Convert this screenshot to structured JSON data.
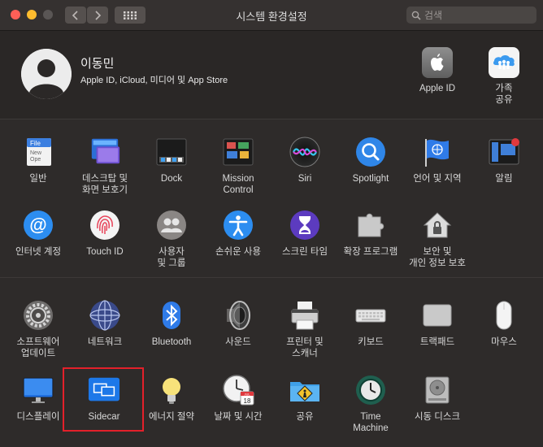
{
  "window": {
    "title": "시스템 환경설정"
  },
  "search": {
    "placeholder": "검색"
  },
  "account": {
    "name": "이동민",
    "subtitle": "Apple ID, iCloud, 미디어 및 App Store",
    "apple_id_label": "Apple ID",
    "family_label_1": "가족",
    "family_label_2": "공유"
  },
  "prefs": {
    "general": "일반",
    "desktop_1": "데스크탑 및",
    "desktop_2": "화면 보호기",
    "dock": "Dock",
    "mission_1": "Mission",
    "mission_2": "Control",
    "siri": "Siri",
    "spotlight": "Spotlight",
    "language": "언어 및 지역",
    "notifications": "알림",
    "internet": "인터넷 계정",
    "touchid": "Touch ID",
    "users_1": "사용자",
    "users_2": "및 그룹",
    "accessibility": "손쉬운 사용",
    "screentime": "스크린 타임",
    "extensions": "확장 프로그램",
    "security_1": "보안 및",
    "security_2": "개인 정보 보호",
    "software_1": "소프트웨어",
    "software_2": "업데이트",
    "network": "네트워크",
    "bluetooth": "Bluetooth",
    "sound": "사운드",
    "printers_1": "프린터 및",
    "printers_2": "스캐너",
    "keyboard": "키보드",
    "trackpad": "트랙패드",
    "mouse": "마우스",
    "displays": "디스플레이",
    "sidecar": "Sidecar",
    "energy": "에너지 절약",
    "datetime": "날짜 및 시간",
    "sharing": "공유",
    "timemachine_1": "Time",
    "timemachine_2": "Machine",
    "startup": "시동 디스크"
  },
  "calendar": {
    "month": "JUL",
    "day": "18"
  },
  "highlighted_item": "Sidecar",
  "colors": {
    "highlight": "#e3202a",
    "accent_blue": "#1e6fd9"
  }
}
